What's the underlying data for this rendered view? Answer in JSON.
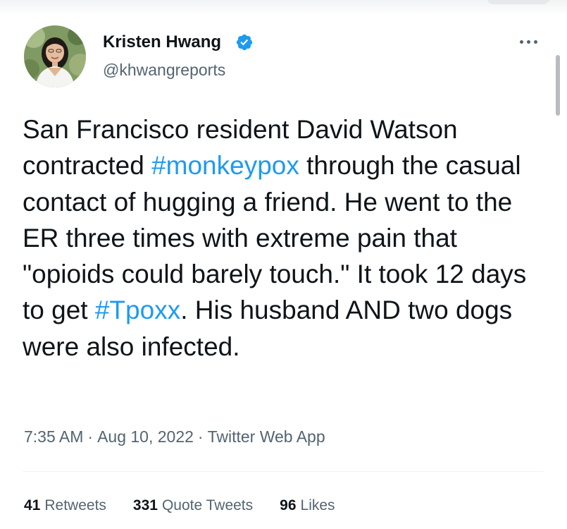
{
  "author": {
    "name": "Kristen Hwang",
    "handle": "@khwangreports",
    "verified": true
  },
  "tweet": {
    "segments": [
      {
        "text": "San Francisco resident David Watson contracted ",
        "type": "text"
      },
      {
        "text": "#monkeypox",
        "type": "hashtag"
      },
      {
        "text": " through the casual contact of hugging a friend. He went to the ER three times with extreme pain that \"opioids could barely touch.\" It took 12 days to get ",
        "type": "text"
      },
      {
        "text": "#Tpoxx",
        "type": "hashtag"
      },
      {
        "text": ". His husband AND two dogs were also infected.",
        "type": "text"
      }
    ]
  },
  "meta": {
    "time": "7:35 AM",
    "date": "Aug 10, 2022",
    "source": "Twitter Web App",
    "separator": "·"
  },
  "stats": {
    "retweets_count": "41",
    "retweets_label": "Retweets",
    "quotes_count": "331",
    "quotes_label": "Quote Tweets",
    "likes_count": "96",
    "likes_label": "Likes"
  },
  "icons": {
    "verified": "verified-badge-icon",
    "more": "more-options-icon"
  },
  "colors": {
    "link": "#1d9bf0",
    "text": "#0f1419",
    "secondary": "#536471"
  }
}
